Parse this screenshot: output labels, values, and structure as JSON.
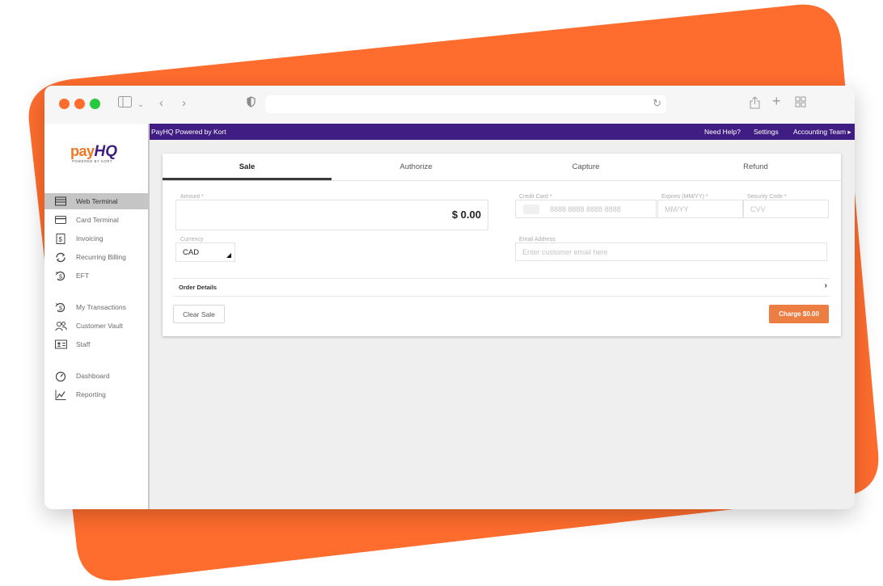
{
  "colors": {
    "accent_orange": "#FF6D2E",
    "nav_purple": "#3F1D82",
    "charge_button": "#EC7D43",
    "sidebar_active": "#C5C5C5"
  },
  "topnav": {
    "brand": "PayHQ Powered by Kort",
    "help": "Need Help?",
    "settings": "Settings",
    "account": "Accounting Team ▸"
  },
  "sidebar": {
    "logo": {
      "pay": "pay",
      "hq": "HQ",
      "tagline": "POWERED BY KORT"
    },
    "items": [
      {
        "label": "Web Terminal",
        "icon": "terminal-icon",
        "active": true
      },
      {
        "label": "Card Terminal",
        "icon": "card-icon",
        "active": false
      },
      {
        "label": "Invoicing",
        "icon": "invoice-icon",
        "active": false
      },
      {
        "label": "Recurring Billing",
        "icon": "refresh-icon",
        "active": false
      },
      {
        "label": "EFT",
        "icon": "eft-icon",
        "active": false
      },
      {
        "label": "My Transactions",
        "icon": "transactions-icon",
        "active": false
      },
      {
        "label": "Customer Vault",
        "icon": "users-icon",
        "active": false
      },
      {
        "label": "Staff",
        "icon": "id-card-icon",
        "active": false
      },
      {
        "label": "Dashboard",
        "icon": "gauge-icon",
        "active": false
      },
      {
        "label": "Reporting",
        "icon": "chart-icon",
        "active": false
      }
    ]
  },
  "tabs": [
    {
      "label": "Sale",
      "active": true
    },
    {
      "label": "Authorize",
      "active": false
    },
    {
      "label": "Capture",
      "active": false
    },
    {
      "label": "Refund",
      "active": false
    }
  ],
  "form": {
    "amount_label": "Amount *",
    "amount_value": "$ 0.00",
    "currency_label": "Currency",
    "currency_value": "CAD",
    "card_label": "Credit Card *",
    "card_placeholder": "8888 8888 8888 8888",
    "expires_label": "Expires (MM/YY) *",
    "expires_placeholder": "MM/YY",
    "cvv_label": "Security Code *",
    "cvv_placeholder": "CVV",
    "email_label": "Email Address",
    "email_placeholder": "Enter customer email here",
    "order_details": "Order Details"
  },
  "actions": {
    "clear": "Clear Sale",
    "charge": "Charge $0.00"
  }
}
